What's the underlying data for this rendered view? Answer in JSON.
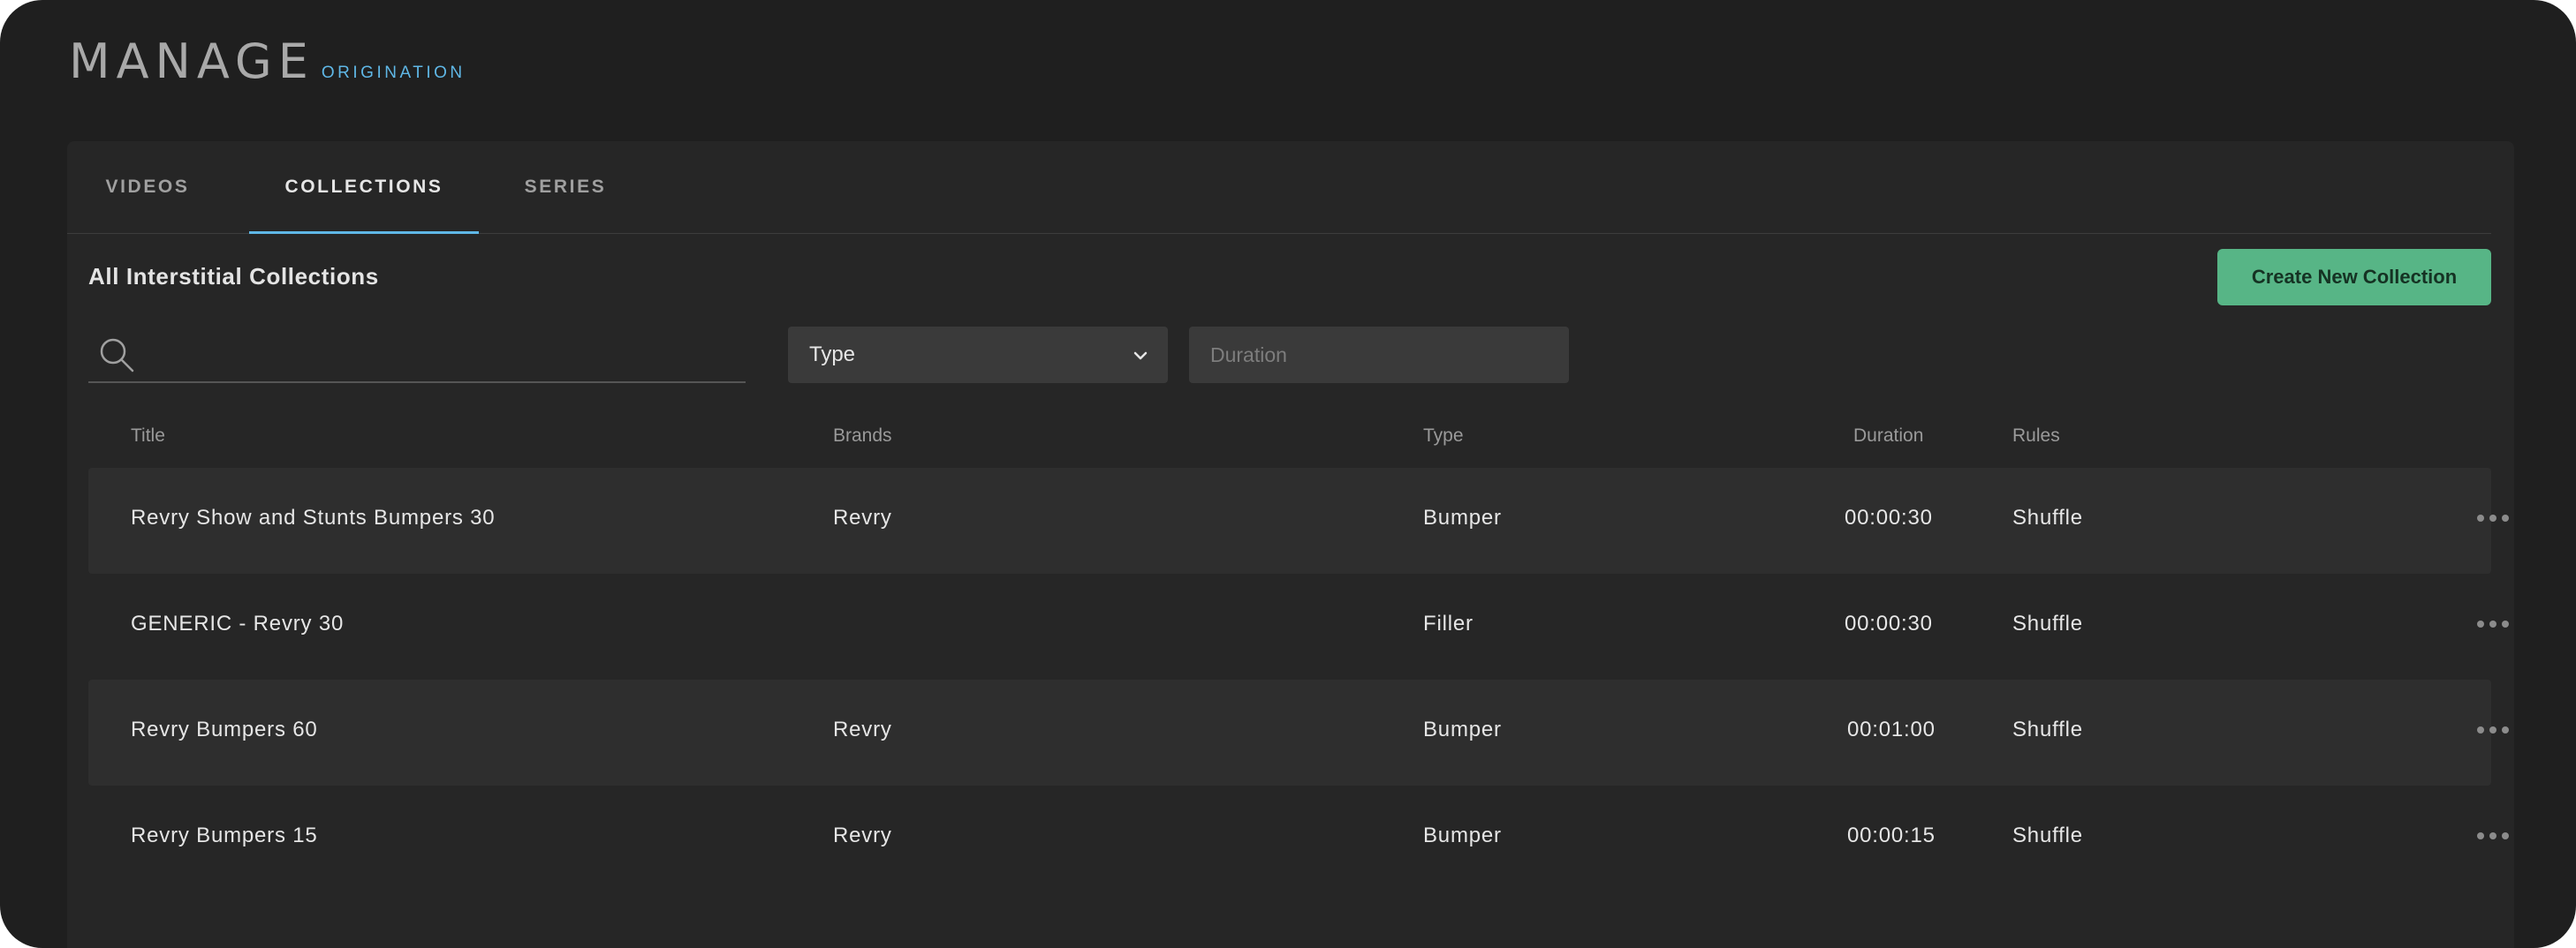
{
  "brand": {
    "title": "MANAGE",
    "subtitle": "ORIGINATION"
  },
  "tabs": [
    {
      "label": "VIDEOS",
      "active": false
    },
    {
      "label": "COLLECTIONS",
      "active": true
    },
    {
      "label": "SERIES",
      "active": false
    }
  ],
  "section_title": "All Interstitial Collections",
  "create_button": {
    "label": "Create New Collection"
  },
  "filters": {
    "search": {
      "value": "",
      "placeholder": ""
    },
    "type": {
      "selected": "Type"
    },
    "duration": {
      "value": "",
      "placeholder": "Duration"
    }
  },
  "table": {
    "headers": {
      "title": "Title",
      "brands": "Brands",
      "type": "Type",
      "duration": "Duration",
      "rules": "Rules"
    },
    "rows": [
      {
        "title": "Revry Show and Stunts Bumpers 30",
        "brands": "Revry",
        "type": "Bumper",
        "duration": "00:00:30",
        "rules": "Shuffle"
      },
      {
        "title": "GENERIC - Revry 30",
        "brands": "",
        "type": "Filler",
        "duration": "00:00:30",
        "rules": "Shuffle"
      },
      {
        "title": "Revry Bumpers 60",
        "brands": "Revry",
        "type": "Bumper",
        "duration": "00:01:00",
        "rules": "Shuffle"
      },
      {
        "title": "Revry Bumpers 15",
        "brands": "Revry",
        "type": "Bumper",
        "duration": "00:00:15",
        "rules": "Shuffle"
      }
    ]
  },
  "icons": {
    "search": "search-icon",
    "chevron": "chevron-down-icon",
    "more": "more-horizontal-icon"
  },
  "colors": {
    "accent": "#5fb7e6",
    "primary_button": "#57b586",
    "background": "#1f1f1f",
    "panel": "#262626"
  }
}
